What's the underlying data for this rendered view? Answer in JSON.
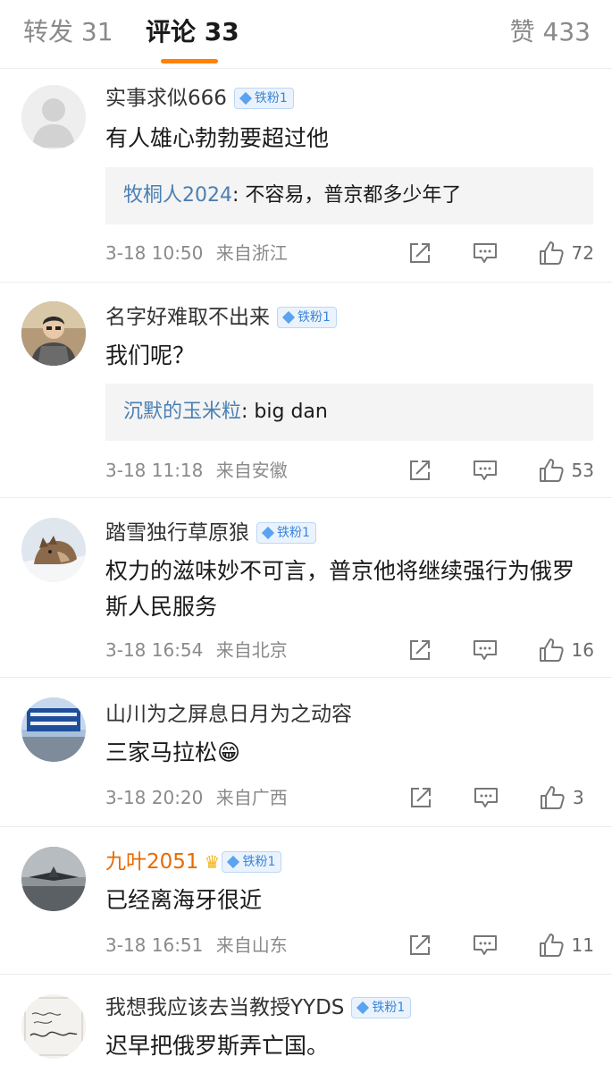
{
  "tabs": {
    "repost": "转发 31",
    "comments": "评论 33",
    "likes": "赞 433"
  },
  "colors": {
    "accent": "#ff8200",
    "reply_name": "#4a80b4",
    "vip_name": "#e86a00",
    "badge": "#3a84d8"
  },
  "comments": [
    {
      "user": "实事求似666",
      "badge": "铁粉1",
      "text": "有人雄心勃勃要超过他",
      "reply": {
        "user": "牧桐人2024",
        "text": ": 不容易，普京都多少年了"
      },
      "time": "3-18 10:50",
      "location": "来自浙江",
      "likes": "72"
    },
    {
      "user": "名字好难取不出来",
      "badge": "铁粉1",
      "text": "我们呢？",
      "reply": {
        "user": "沉默的玉米粒",
        "text": ": big dan"
      },
      "time": "3-18 11:18",
      "location": "来自安徽",
      "likes": "53"
    },
    {
      "user": "踏雪独行草原狼",
      "badge": "铁粉1",
      "text": "权力的滋味妙不可言，普京他将继续强行为俄罗斯人民服务",
      "time": "3-18 16:54",
      "location": "来自北京",
      "likes": "16"
    },
    {
      "user": "山川为之屏息日月为之动容",
      "text": "三家马拉松😁",
      "time": "3-18 20:20",
      "location": "来自广西",
      "likes": "3"
    },
    {
      "user": "九叶2051",
      "badge": "铁粉1",
      "text": "已经离海牙很近",
      "time": "3-18 16:51",
      "location": "来自山东",
      "likes": "11"
    },
    {
      "user": "我想我应该去当教授YYDS",
      "badge": "铁粉1",
      "text": "迟早把俄罗斯弄亡国。"
    }
  ]
}
